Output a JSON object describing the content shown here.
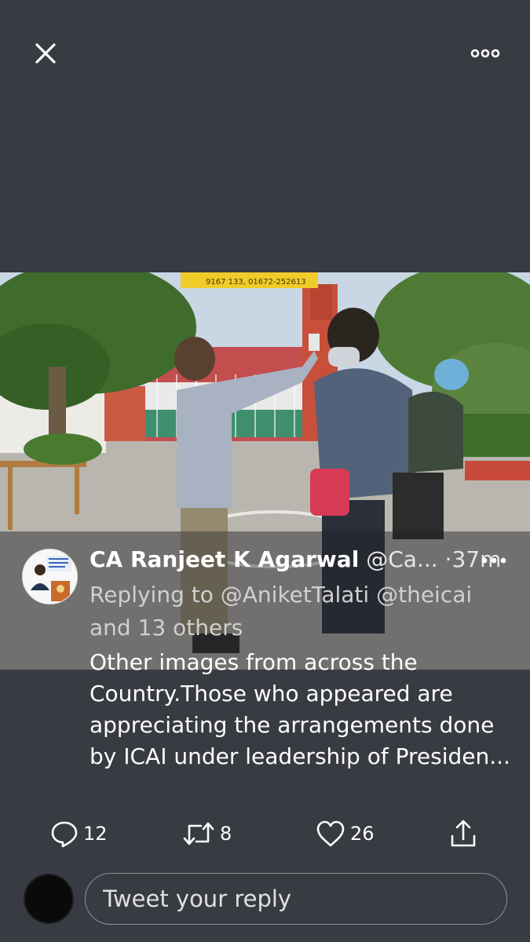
{
  "viewer": {
    "close_icon": "close-icon",
    "more_icon": "more-horizontal-icon"
  },
  "banner_text": "9167 133, 01672-252613",
  "tweet": {
    "author_name": "CA Ranjeet K Agarwal",
    "author_handle": "@Ca...",
    "separator": "·",
    "time": "37m",
    "reply_prefix": "Replying to",
    "reply_mentions": "@AniketTalati @theicai",
    "reply_suffix": "and 13 others",
    "body": "Other images from across the Country.Those who appeared are appreciating the arrangements done by ICAI under leadership of Presiden..."
  },
  "actions": {
    "reply": {
      "icon": "reply-icon",
      "count": "12"
    },
    "retweet": {
      "icon": "retweet-icon",
      "count": "8"
    },
    "like": {
      "icon": "heart-icon",
      "count": "26"
    },
    "share": {
      "icon": "share-icon"
    }
  },
  "composer": {
    "placeholder": "Tweet your reply"
  }
}
